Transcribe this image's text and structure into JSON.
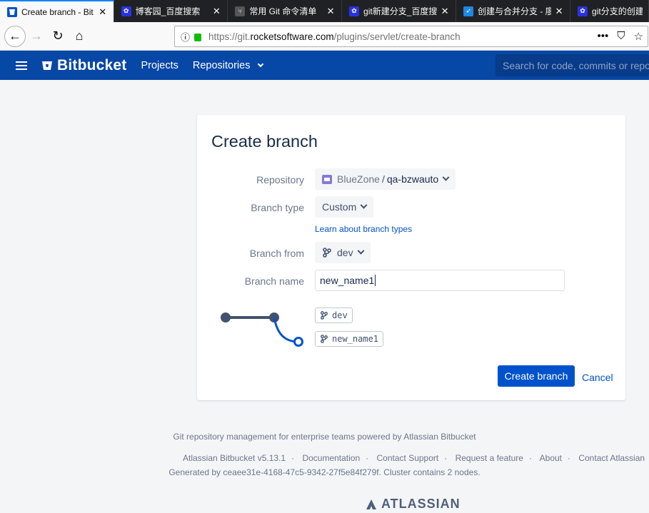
{
  "browser": {
    "tabs": [
      {
        "title": "Create branch - Bit",
        "active": true,
        "icon": "bitbucket-icon"
      },
      {
        "title": "博客园_百度搜索",
        "active": false,
        "icon": "baidu-paw-icon"
      },
      {
        "title": "常用 Git 命令清单",
        "active": false,
        "icon": "git-icon"
      },
      {
        "title": "git新建分支_百度搜",
        "active": false,
        "icon": "baidu-paw-icon"
      },
      {
        "title": "创建与合并分支 - 廖",
        "active": false,
        "icon": "rocket-icon"
      },
      {
        "title": "git分支的创建、",
        "active": false,
        "icon": "baidu-paw-icon"
      }
    ],
    "url_prefix": "https://git.",
    "url_host": "rocketsoftware.com",
    "url_path": "/plugins/servlet/create-branch"
  },
  "header": {
    "logo": "Bitbucket",
    "projects": "Projects",
    "repositories": "Repositories",
    "search_placeholder": "Search for code, commits or repos"
  },
  "form": {
    "title": "Create branch",
    "repository_label": "Repository",
    "repository_project": "BlueZone",
    "repository_separator": "/",
    "repository_name": "qa-bzwauto",
    "branch_type_label": "Branch type",
    "branch_type_value": "Custom",
    "learn_link": "Learn about branch types",
    "branch_from_label": "Branch from",
    "branch_from_value": "dev",
    "branch_name_label": "Branch name",
    "branch_name_value": "new_name1",
    "diagram_from": "dev",
    "diagram_new": "new_name1",
    "create_button": "Create branch",
    "cancel_link": "Cancel"
  },
  "footer": {
    "tagline": "Git repository management for enterprise teams powered by Atlassian Bitbucket",
    "links": [
      "Atlassian Bitbucket v5.13.1",
      "Documentation",
      "Contact Support",
      "Request a feature",
      "About",
      "Contact Atlassian"
    ],
    "generated": "Generated by ceaee31e-4168-47c5-9342-27f5e84f279f. Cluster contains 2 nodes.",
    "brand": "ATLASSIAN"
  },
  "colors": {
    "header_bg": "#0747a6",
    "primary": "#0052cc",
    "page_bg": "#f4f5f7"
  }
}
